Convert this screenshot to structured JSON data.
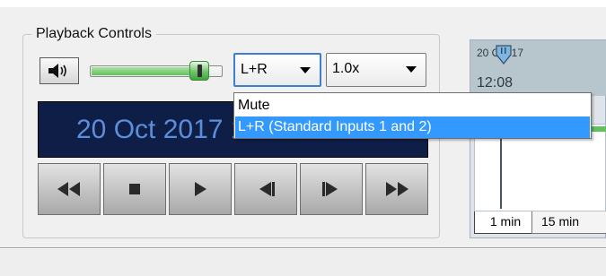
{
  "group_title": "Playback Controls",
  "icons": {
    "speaker": "speaker-icon",
    "rewind": "rewind-icon",
    "stop": "stop-icon",
    "play": "play-icon",
    "step_back": "step-back-icon",
    "step_forward": "step-forward-icon",
    "fast_forward": "fast-forward-icon",
    "dropdown_arrow": "chevron-down-icon",
    "playhead": "playhead-marker-icon"
  },
  "volume": {
    "level": 0.88
  },
  "channel_select": {
    "value": "L+R",
    "options": [
      "Mute",
      "L+R  (Standard Inputs 1 and 2)"
    ],
    "highlighted_index": 1
  },
  "speed_select": {
    "value": "1.0x"
  },
  "clock_display": "20 Oct 2017   12:08:00",
  "timeline": {
    "date_line1": "20 Oct 17",
    "date_line2": "12:08",
    "tabs": [
      "1 min",
      "15 min"
    ]
  },
  "colors": {
    "selection": "#3399ff",
    "clock_bg": "#0e1e46",
    "clock_text": "#5b8fdc",
    "volume_fill": "#62c15c"
  }
}
